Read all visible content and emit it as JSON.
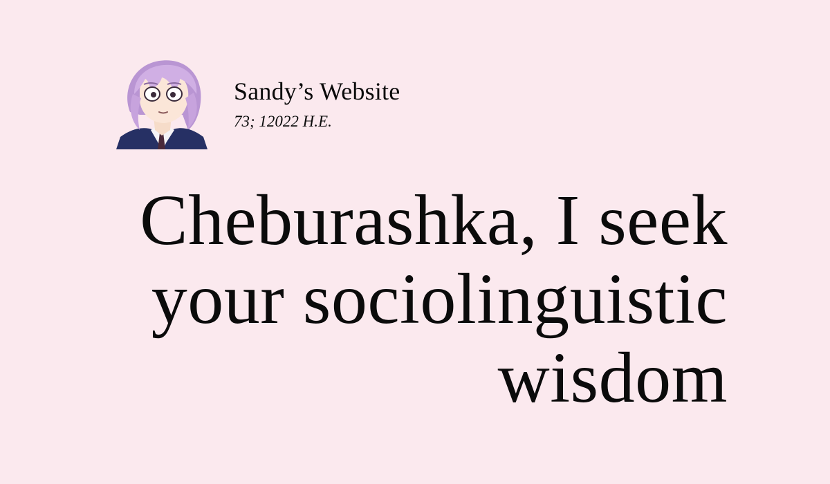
{
  "site": {
    "name": "Sandy’s Website",
    "date": "73; 12022 H.E."
  },
  "post": {
    "title": "Cheburashka, I seek your sociolinguistic wisdom"
  },
  "avatar": {
    "description": "avatar",
    "hair_color": "#c9a6dd",
    "background_color": "#fbe9ee"
  }
}
